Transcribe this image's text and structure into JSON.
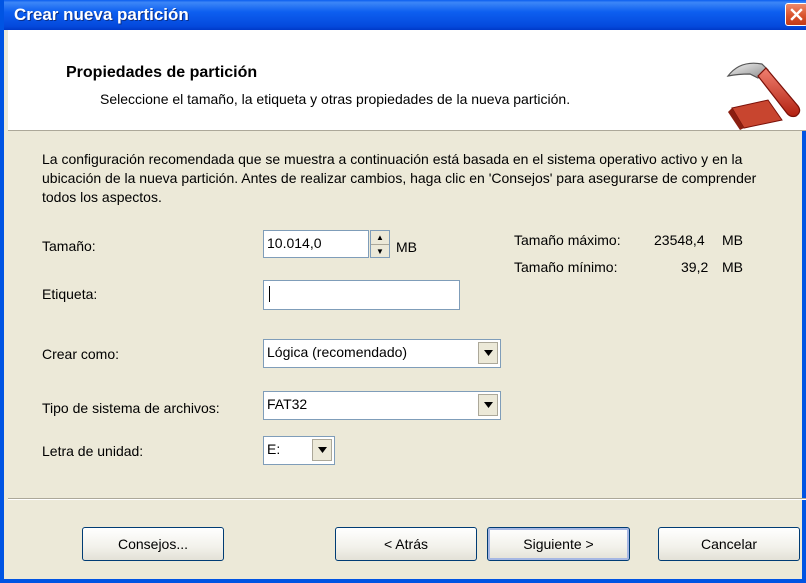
{
  "window": {
    "title": "Crear nueva partición"
  },
  "header": {
    "title": "Propiedades de partición",
    "description": "Seleccione el tamaño, la etiqueta y otras propiedades de la nueva partición.",
    "icon": "hammer-icon"
  },
  "intro": "La configuración recomendada que se muestra a continuación está basada en el sistema operativo activo y en la ubicación de la nueva partición. Antes de realizar cambios, haga clic en 'Consejos' para asegurarse de comprender todos los aspectos.",
  "size": {
    "label": "Tamaño:",
    "value": "10.014,0",
    "unit": "MB"
  },
  "stats": {
    "max_label": "Tamaño máximo:",
    "max_value": "23548,4",
    "max_unit": "MB",
    "min_label": "Tamaño mínimo:",
    "min_value": "39,2",
    "min_unit": "MB"
  },
  "label_field": {
    "label": "Etiqueta:",
    "value": ""
  },
  "create_as": {
    "label": "Crear como:",
    "value": "Lógica (recomendado)"
  },
  "fs_type": {
    "label": "Tipo de sistema de archivos:",
    "value": "FAT32"
  },
  "drive_letter": {
    "label": "Letra de unidad:",
    "value": "E:"
  },
  "buttons": {
    "tips": "Consejos...",
    "back": "< Atrás",
    "next": "Siguiente >",
    "cancel": "Cancelar"
  },
  "colors": {
    "titlebar": "#0054e3",
    "background": "#ece9d8",
    "accent_red": "#c0392b"
  }
}
